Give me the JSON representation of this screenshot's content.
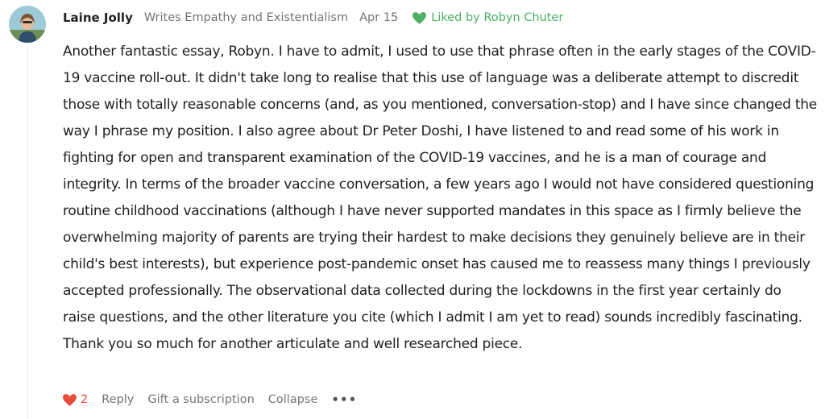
{
  "comment": {
    "author": "Laine Jolly",
    "bio": "Writes Empathy and Existentialism",
    "date": "Apr 15",
    "liked_by": "Liked by Robyn Chuter",
    "body": "Another fantastic essay, Robyn. I have to admit, I used to use that phrase often in the early stages of the COVID-19 vaccine roll-out. It didn't take long to realise that this use of language was a deliberate attempt to discredit those with totally reasonable concerns (and, as you mentioned, conversation-stop) and I have since changed the way I phrase my position. I also agree about Dr Peter Doshi, I have listened to and read some of his work in fighting for open and transparent examination of the COVID-19 vaccines, and he is a man of courage and integrity. In terms of the broader vaccine conversation, a few years ago I would not have considered questioning routine childhood vaccinations (although I have never supported mandates in this space as I firmly believe the overwhelming majority of parents are trying their hardest to make decisions they genuinely believe are in their child's best interests), but experience post-pandemic onset has caused me to reassess many things I previously accepted professionally. The observational data collected during the lockdowns in the first year certainly do raise questions, and the other literature you cite (which I admit I am yet to read) sounds incredibly fascinating. Thank you so much for another articulate and well researched piece."
  },
  "actions": {
    "like_count": "2",
    "reply_label": "Reply",
    "gift_label": "Gift a subscription",
    "collapse_label": "Collapse",
    "more_label": "•••"
  },
  "colors": {
    "liked_green": "#4caf63",
    "heart_red": "#e74c3c",
    "meta_gray": "#757575"
  }
}
